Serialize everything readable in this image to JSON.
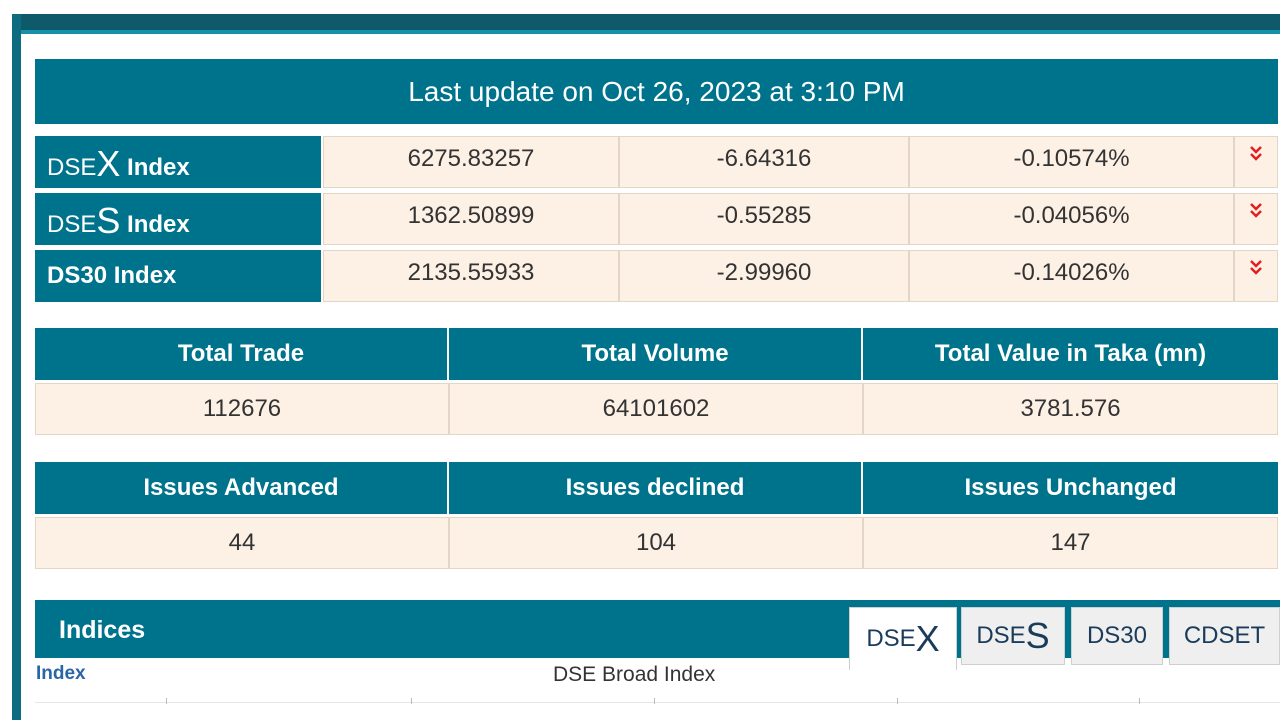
{
  "update": {
    "text": "Last update on Oct 26, 2023 at 3:10 PM"
  },
  "indices": [
    {
      "prefix": "DSE",
      "big": "X",
      "suffix": "Index",
      "value": "6275.83257",
      "change": "-6.64316",
      "pct": "-0.10574%",
      "trend_icon": "double-chevron-down"
    },
    {
      "prefix": "DSE",
      "big": "S",
      "suffix": "Index",
      "value": "1362.50899",
      "change": "-0.55285",
      "pct": "-0.04056%",
      "trend_icon": "double-chevron-down"
    },
    {
      "prefix": "",
      "big": "",
      "suffix": "DS30 Index",
      "value": "2135.55933",
      "change": "-2.99960",
      "pct": "-0.14026%",
      "trend_icon": "double-chevron-down"
    }
  ],
  "totals": {
    "headers": [
      "Total Trade",
      "Total Volume",
      "Total Value in Taka (mn)"
    ],
    "values": [
      "112676",
      "64101602",
      "3781.576"
    ]
  },
  "issues": {
    "headers": [
      "Issues Advanced",
      "Issues declined",
      "Issues Unchanged"
    ],
    "values": [
      "44",
      "104",
      "147"
    ]
  },
  "indices_panel": {
    "title": "Indices",
    "tabs": [
      {
        "prefix": "DSE",
        "big": "X",
        "active": true
      },
      {
        "prefix": "DSE",
        "big": "S",
        "active": false
      },
      {
        "label": "DS30",
        "active": false
      },
      {
        "label": "CDSET",
        "active": false
      }
    ],
    "index_label": "Index",
    "chart_title": "DSE Broad Index"
  },
  "colors": {
    "header_bg": "#00738c",
    "cell_bg": "#fdf1e6",
    "down_arrow": "#e02020"
  }
}
